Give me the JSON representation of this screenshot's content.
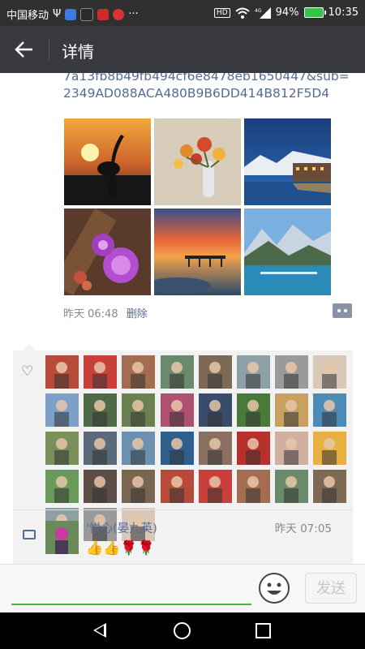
{
  "status_bar": {
    "carrier": "中国移动",
    "network": "4G",
    "hd": "HD",
    "battery": "94%",
    "time": "10:35"
  },
  "header": {
    "title": "详情",
    "back_icon": "arrow-left-icon"
  },
  "post": {
    "link_text": "7a13fb8b49fb494cf6e8478eb1650447&sub=2349AD088ACA480B9B6DD414B812F5D4",
    "time": "昨天 06:48",
    "delete_label": "删除",
    "photos": [
      {
        "scene": "sunset-bird"
      },
      {
        "scene": "roses-vase"
      },
      {
        "scene": "night-canal"
      },
      {
        "scene": "purple-flowers"
      },
      {
        "scene": "sunset-sea"
      },
      {
        "scene": "mountain-lake"
      }
    ]
  },
  "likes": {
    "icon": "heart-icon",
    "avatar_count": 35,
    "avatar_colors": [
      "#b84a3a",
      "#c9403a",
      "#a56d50",
      "#6a8a6c",
      "#7c6a55",
      "#8ca0a6",
      "#9a9a9a",
      "#d8c8b8",
      "#7da0c9",
      "#4f6a46",
      "#6a8050",
      "#b05070",
      "#3a4c6b",
      "#4a7a3a",
      "#c8a060",
      "#4c8ab8",
      "#7a8f5a",
      "#5a6a7a",
      "#6c90b0",
      "#2f5f8f",
      "#8a7060",
      "#b8302c",
      "#d0b0a0",
      "#e8b040",
      "#6a9a5a",
      "#5a4e46",
      "#7a6650"
    ]
  },
  "comment": {
    "icon": "comment-icon",
    "author": "'悦心(晏九英)",
    "time": "昨天 07:05",
    "text": "👍👍🌹🌹"
  },
  "input_bar": {
    "send_label": "发送",
    "emoji_icon": "smiley-icon",
    "accent": "#3fb83c"
  },
  "nav_bar": {
    "back_icon": "triangle-back-icon",
    "home_icon": "circle-home-icon",
    "recent_icon": "square-recent-icon"
  }
}
